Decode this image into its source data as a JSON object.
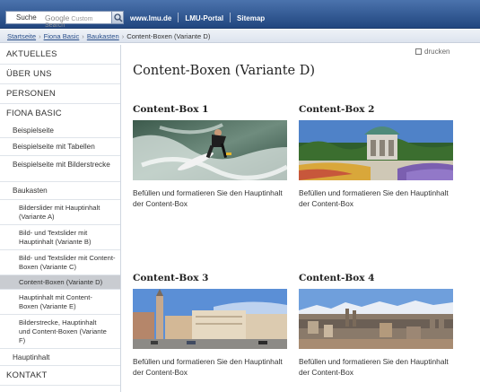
{
  "topbar": {
    "search_label": "Suche",
    "search_provider": "Google",
    "search_provider_suffix": "Custom Search",
    "search_button_icon": "search-icon",
    "links": [
      "www.lmu.de",
      "LMU-Portal",
      "Sitemap"
    ]
  },
  "breadcrumb": [
    "Startseite",
    "Fiona Basic",
    "Baukasten",
    "Content-Boxen (Variante D)"
  ],
  "sidebar": {
    "items": [
      {
        "label": "AKTUELLES",
        "level": 0
      },
      {
        "label": "ÜBER UNS",
        "level": 0
      },
      {
        "label": "PERSONEN",
        "level": 0
      },
      {
        "label": "FIONA BASIC",
        "level": 0
      },
      {
        "label": "Beispielseite",
        "level": 1
      },
      {
        "label": "Beispielseite mit Tabellen",
        "level": 1
      },
      {
        "label": "Beispielseite mit Bilderstrecke",
        "level": 1
      },
      {
        "label": "Baukasten",
        "level": 1
      },
      {
        "label": "Bilderslider mit Hauptinhalt (Variante A)",
        "level": 2
      },
      {
        "label": "Bild- und Textslider mit Hauptinhalt (Variante B)",
        "level": 2
      },
      {
        "label": "Bild- und Textslider mit Content-Boxen (Variante C)",
        "level": 2
      },
      {
        "label": "Content-Boxen (Variante D)",
        "level": 2,
        "active": true
      },
      {
        "label": "Hauptinhalt mit Content-Boxen (Variante E)",
        "level": 2
      },
      {
        "label": "Bilderstrecke, Hauptinhalt und Content-Boxen (Variante F)",
        "level": 2
      },
      {
        "label": "Hauptinhalt",
        "level": 1
      },
      {
        "label": "KONTAKT",
        "level": 0
      }
    ]
  },
  "print": {
    "label": "drucken",
    "icon": "print-icon"
  },
  "main": {
    "title": "Content-Boxen (Variante D)",
    "boxes": [
      {
        "title": "Content-Box 1",
        "image": "surfer-photo",
        "text": "Befüllen und formatieren Sie den Hauptinhalt der Content-Box"
      },
      {
        "title": "Content-Box 2",
        "image": "pavilion-garden-photo",
        "text": "Befüllen und formatieren Sie den Hauptinhalt der Content-Box"
      },
      {
        "title": "Content-Box 3",
        "image": "city-street-photo",
        "text": "Befüllen und formatieren Sie den Hauptinhalt der Content-Box"
      },
      {
        "title": "Content-Box 4",
        "image": "city-panorama-photo",
        "text": "Befüllen und formatieren Sie den Hauptinhalt der Content-Box"
      }
    ]
  },
  "colors": {
    "topbar": "#2f5691",
    "active_nav": "#c9ccd1",
    "link": "#2a4f8a"
  }
}
